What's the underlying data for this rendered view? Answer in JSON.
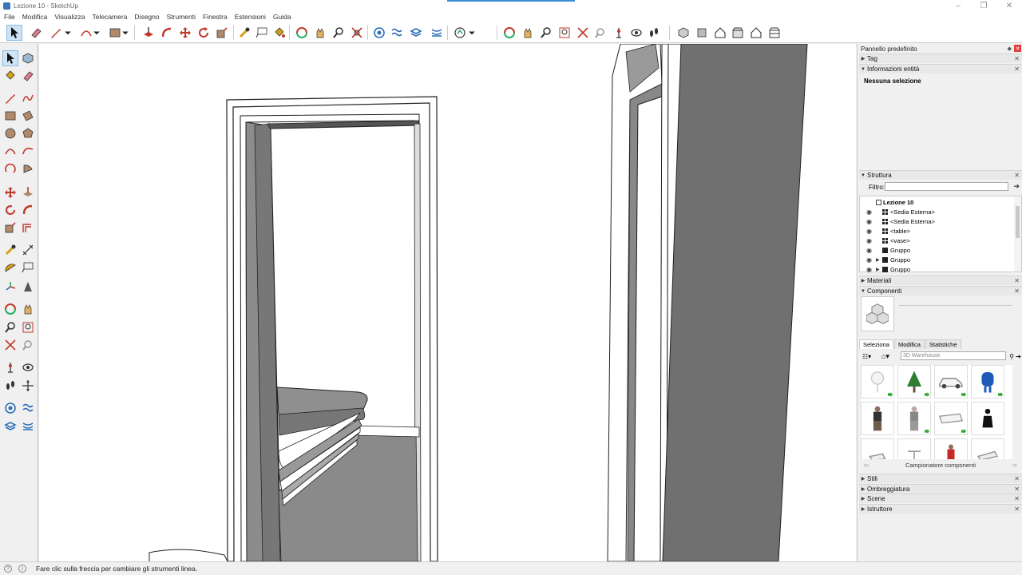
{
  "window": {
    "title": "Lezione 10 - SketchUp"
  },
  "menu": [
    "File",
    "Modifica",
    "Visualizza",
    "Telecamera",
    "Disegno",
    "Strumenti",
    "Finestra",
    "Estensioni",
    "Guida"
  ],
  "statusbar": {
    "hint": "Fare clic sulla freccia per cambiare gli strumenti linea."
  },
  "panel": {
    "title": "Pannello predefinito",
    "sections": {
      "tag": "Tag",
      "entity_info": "Informazioni entità",
      "no_selection": "Nessuna selezione",
      "outliner": "Struttura",
      "filter_label": "Filtro:",
      "materials": "Materiali",
      "components": "Componenti",
      "styles": "Stili",
      "shadows": "Ombreggiatura",
      "scenes": "Scene",
      "instructor": "Istruttore"
    },
    "outliner_items": [
      {
        "label": "Lezione 10",
        "kind": "root"
      },
      {
        "label": "<Sedia Esterna>",
        "kind": "component"
      },
      {
        "label": "<Sedia Esterna>",
        "kind": "component"
      },
      {
        "label": "<table>",
        "kind": "component"
      },
      {
        "label": "<vase>",
        "kind": "component"
      },
      {
        "label": "Gruppo",
        "kind": "group"
      },
      {
        "label": "Gruppo",
        "kind": "group"
      },
      {
        "label": "Gruppo",
        "kind": "group"
      }
    ],
    "component_tabs": [
      "Seleziona",
      "Modifica",
      "Statistiche"
    ],
    "component_search_placeholder": "3D Warehouse",
    "component_sampler": "Campionatore componenti"
  },
  "colors": {
    "accent": "#3b8bd6",
    "close": "#e04040",
    "active_tool": "#cfe3f7"
  },
  "icons": [
    "select-icon",
    "eraser-icon",
    "pencil-icon",
    "arc-icon",
    "rectangle-icon",
    "push-pull-icon",
    "move-icon",
    "rotate-icon",
    "scale-icon",
    "tape-measure-icon",
    "text-icon",
    "paint-bucket-icon",
    "orbit-icon",
    "pan-icon",
    "zoom-icon",
    "zoom-extents-icon",
    "component-icon",
    "warehouse-icon",
    "house-icon"
  ]
}
